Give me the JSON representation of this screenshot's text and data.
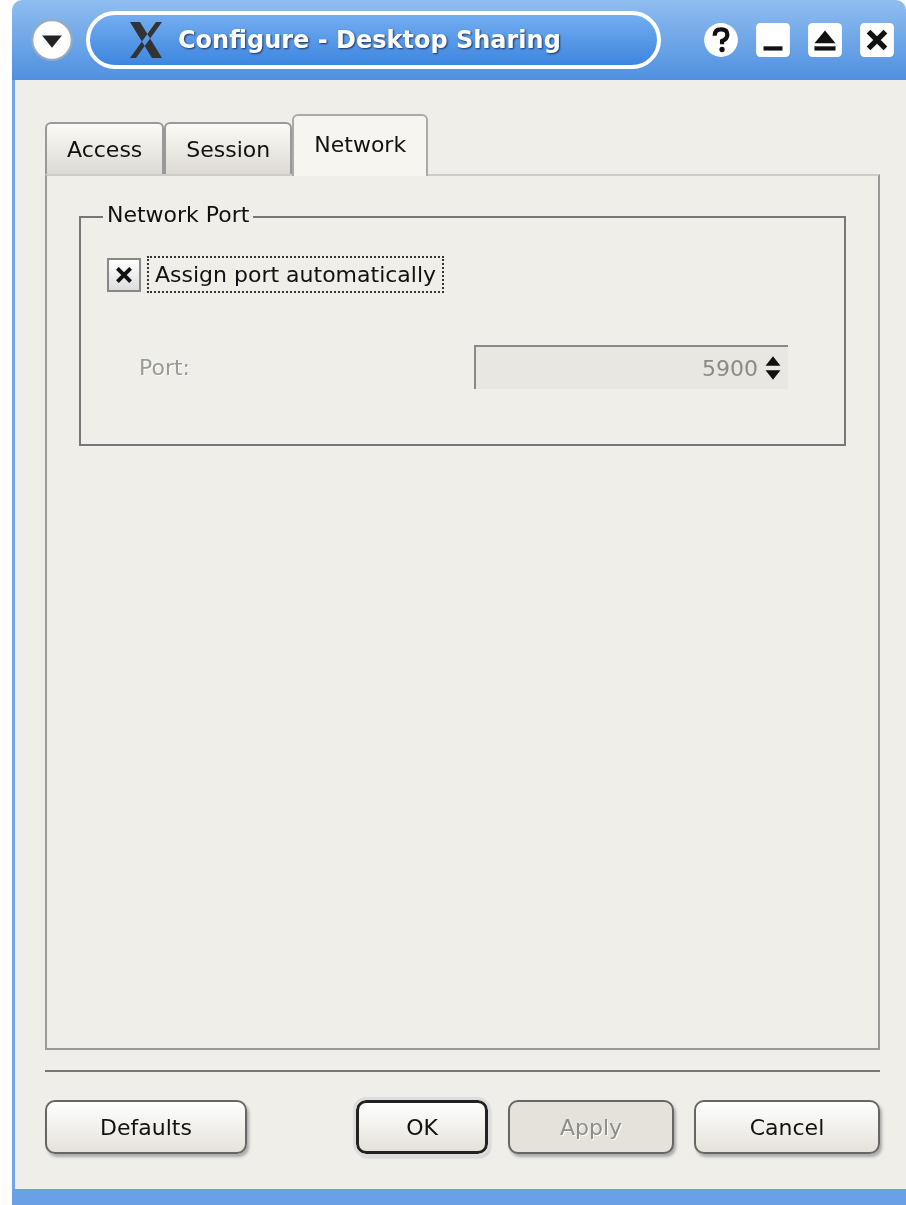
{
  "window": {
    "title": "Configure - Desktop Sharing"
  },
  "tabs": [
    {
      "label": "Access",
      "selected": false
    },
    {
      "label": "Session",
      "selected": false
    },
    {
      "label": "Network",
      "selected": true
    }
  ],
  "group": {
    "title": "Network Port",
    "checkbox": {
      "label": "Assign port automatically",
      "checked": true,
      "focused": true
    },
    "port": {
      "label": "Port:",
      "value": "5900",
      "disabled": true
    }
  },
  "buttons": [
    {
      "label": "Defaults",
      "default": false,
      "disabled": false
    },
    {
      "label": "OK",
      "default": true,
      "disabled": false
    },
    {
      "label": "Apply",
      "default": false,
      "disabled": true
    },
    {
      "label": "Cancel",
      "default": false,
      "disabled": false
    }
  ]
}
